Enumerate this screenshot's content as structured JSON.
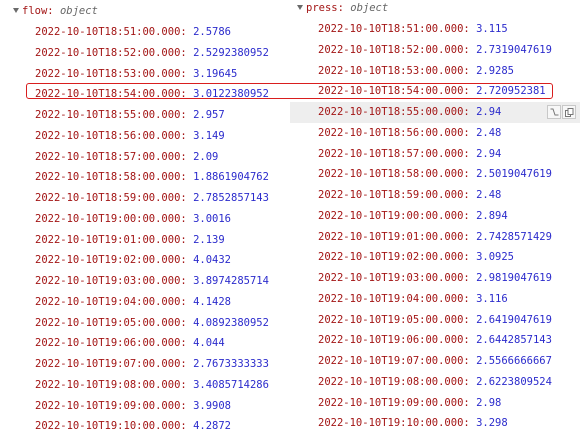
{
  "flow": {
    "key": "flow",
    "type": "object",
    "entries": [
      {
        "key": "2022-10-10T18:51:00.000",
        "value": "2.5786"
      },
      {
        "key": "2022-10-10T18:52:00.000",
        "value": "2.5292380952"
      },
      {
        "key": "2022-10-10T18:53:00.000",
        "value": "3.19645"
      },
      {
        "key": "2022-10-10T18:54:00.000",
        "value": "3.0122380952"
      },
      {
        "key": "2022-10-10T18:55:00.000",
        "value": "2.957"
      },
      {
        "key": "2022-10-10T18:56:00.000",
        "value": "3.149"
      },
      {
        "key": "2022-10-10T18:57:00.000",
        "value": "2.09"
      },
      {
        "key": "2022-10-10T18:58:00.000",
        "value": "1.8861904762"
      },
      {
        "key": "2022-10-10T18:59:00.000",
        "value": "2.7852857143"
      },
      {
        "key": "2022-10-10T19:00:00.000",
        "value": "3.0016"
      },
      {
        "key": "2022-10-10T19:01:00.000",
        "value": "2.139"
      },
      {
        "key": "2022-10-10T19:02:00.000",
        "value": "4.0432"
      },
      {
        "key": "2022-10-10T19:03:00.000",
        "value": "3.8974285714"
      },
      {
        "key": "2022-10-10T19:04:00.000",
        "value": "4.1428"
      },
      {
        "key": "2022-10-10T19:05:00.000",
        "value": "4.0892380952"
      },
      {
        "key": "2022-10-10T19:06:00.000",
        "value": "4.044"
      },
      {
        "key": "2022-10-10T19:07:00.000",
        "value": "2.7673333333"
      },
      {
        "key": "2022-10-10T19:08:00.000",
        "value": "3.4085714286"
      },
      {
        "key": "2022-10-10T19:09:00.000",
        "value": "3.9908"
      },
      {
        "key": "2022-10-10T19:10:00.000",
        "value": "4.2872"
      }
    ]
  },
  "press": {
    "key": "press",
    "type": "object",
    "entries": [
      {
        "key": "2022-10-10T18:51:00.000",
        "value": "3.115"
      },
      {
        "key": "2022-10-10T18:52:00.000",
        "value": "2.7319047619"
      },
      {
        "key": "2022-10-10T18:53:00.000",
        "value": "2.9285"
      },
      {
        "key": "2022-10-10T18:54:00.000",
        "value": "2.720952381"
      },
      {
        "key": "2022-10-10T18:55:00.000",
        "value": "2.94"
      },
      {
        "key": "2022-10-10T18:56:00.000",
        "value": "2.48"
      },
      {
        "key": "2022-10-10T18:57:00.000",
        "value": "2.94"
      },
      {
        "key": "2022-10-10T18:58:00.000",
        "value": "2.5019047619"
      },
      {
        "key": "2022-10-10T18:59:00.000",
        "value": "2.48"
      },
      {
        "key": "2022-10-10T19:00:00.000",
        "value": "2.894"
      },
      {
        "key": "2022-10-10T19:01:00.000",
        "value": "2.7428571429"
      },
      {
        "key": "2022-10-10T19:02:00.000",
        "value": "3.0925"
      },
      {
        "key": "2022-10-10T19:03:00.000",
        "value": "2.9819047619"
      },
      {
        "key": "2022-10-10T19:04:00.000",
        "value": "3.116"
      },
      {
        "key": "2022-10-10T19:05:00.000",
        "value": "2.6419047619"
      },
      {
        "key": "2022-10-10T19:06:00.000",
        "value": "2.6442857143"
      },
      {
        "key": "2022-10-10T19:07:00.000",
        "value": "2.5566666667"
      },
      {
        "key": "2022-10-10T19:08:00.000",
        "value": "2.6223809524"
      },
      {
        "key": "2022-10-10T19:09:00.000",
        "value": "2.98"
      },
      {
        "key": "2022-10-10T19:10:00.000",
        "value": "3.298"
      }
    ]
  },
  "highlighted_key": "2022-10-10T18:54:00.000",
  "hovered_row": {
    "column": "press",
    "key": "2022-10-10T18:55:00.000"
  },
  "row_tools": [
    "format-toggle-icon",
    "copy-icon"
  ],
  "colors": {
    "key": "#a31515",
    "value": "#2b2bcc",
    "type": "#666666",
    "highlight_border": "#d91e1e",
    "hover_bg": "#eeeeee"
  }
}
